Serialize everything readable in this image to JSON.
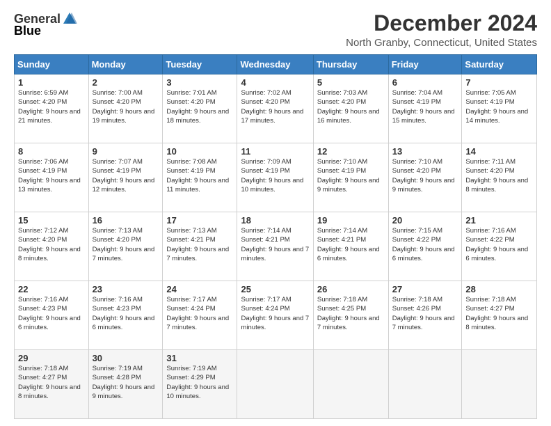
{
  "logo": {
    "general": "General",
    "blue": "Blue"
  },
  "title": "December 2024",
  "location": "North Granby, Connecticut, United States",
  "weekdays": [
    "Sunday",
    "Monday",
    "Tuesday",
    "Wednesday",
    "Thursday",
    "Friday",
    "Saturday"
  ],
  "weeks": [
    [
      {
        "day": "1",
        "sunrise": "6:59 AM",
        "sunset": "4:20 PM",
        "daylight": "9 hours and 21 minutes."
      },
      {
        "day": "2",
        "sunrise": "7:00 AM",
        "sunset": "4:20 PM",
        "daylight": "9 hours and 19 minutes."
      },
      {
        "day": "3",
        "sunrise": "7:01 AM",
        "sunset": "4:20 PM",
        "daylight": "9 hours and 18 minutes."
      },
      {
        "day": "4",
        "sunrise": "7:02 AM",
        "sunset": "4:20 PM",
        "daylight": "9 hours and 17 minutes."
      },
      {
        "day": "5",
        "sunrise": "7:03 AM",
        "sunset": "4:20 PM",
        "daylight": "9 hours and 16 minutes."
      },
      {
        "day": "6",
        "sunrise": "7:04 AM",
        "sunset": "4:19 PM",
        "daylight": "9 hours and 15 minutes."
      },
      {
        "day": "7",
        "sunrise": "7:05 AM",
        "sunset": "4:19 PM",
        "daylight": "9 hours and 14 minutes."
      }
    ],
    [
      {
        "day": "8",
        "sunrise": "7:06 AM",
        "sunset": "4:19 PM",
        "daylight": "9 hours and 13 minutes."
      },
      {
        "day": "9",
        "sunrise": "7:07 AM",
        "sunset": "4:19 PM",
        "daylight": "9 hours and 12 minutes."
      },
      {
        "day": "10",
        "sunrise": "7:08 AM",
        "sunset": "4:19 PM",
        "daylight": "9 hours and 11 minutes."
      },
      {
        "day": "11",
        "sunrise": "7:09 AM",
        "sunset": "4:19 PM",
        "daylight": "9 hours and 10 minutes."
      },
      {
        "day": "12",
        "sunrise": "7:10 AM",
        "sunset": "4:19 PM",
        "daylight": "9 hours and 9 minutes."
      },
      {
        "day": "13",
        "sunrise": "7:10 AM",
        "sunset": "4:20 PM",
        "daylight": "9 hours and 9 minutes."
      },
      {
        "day": "14",
        "sunrise": "7:11 AM",
        "sunset": "4:20 PM",
        "daylight": "9 hours and 8 minutes."
      }
    ],
    [
      {
        "day": "15",
        "sunrise": "7:12 AM",
        "sunset": "4:20 PM",
        "daylight": "9 hours and 8 minutes."
      },
      {
        "day": "16",
        "sunrise": "7:13 AM",
        "sunset": "4:20 PM",
        "daylight": "9 hours and 7 minutes."
      },
      {
        "day": "17",
        "sunrise": "7:13 AM",
        "sunset": "4:21 PM",
        "daylight": "9 hours and 7 minutes."
      },
      {
        "day": "18",
        "sunrise": "7:14 AM",
        "sunset": "4:21 PM",
        "daylight": "9 hours and 7 minutes."
      },
      {
        "day": "19",
        "sunrise": "7:14 AM",
        "sunset": "4:21 PM",
        "daylight": "9 hours and 6 minutes."
      },
      {
        "day": "20",
        "sunrise": "7:15 AM",
        "sunset": "4:22 PM",
        "daylight": "9 hours and 6 minutes."
      },
      {
        "day": "21",
        "sunrise": "7:16 AM",
        "sunset": "4:22 PM",
        "daylight": "9 hours and 6 minutes."
      }
    ],
    [
      {
        "day": "22",
        "sunrise": "7:16 AM",
        "sunset": "4:23 PM",
        "daylight": "9 hours and 6 minutes."
      },
      {
        "day": "23",
        "sunrise": "7:16 AM",
        "sunset": "4:23 PM",
        "daylight": "9 hours and 6 minutes."
      },
      {
        "day": "24",
        "sunrise": "7:17 AM",
        "sunset": "4:24 PM",
        "daylight": "9 hours and 7 minutes."
      },
      {
        "day": "25",
        "sunrise": "7:17 AM",
        "sunset": "4:24 PM",
        "daylight": "9 hours and 7 minutes."
      },
      {
        "day": "26",
        "sunrise": "7:18 AM",
        "sunset": "4:25 PM",
        "daylight": "9 hours and 7 minutes."
      },
      {
        "day": "27",
        "sunrise": "7:18 AM",
        "sunset": "4:26 PM",
        "daylight": "9 hours and 7 minutes."
      },
      {
        "day": "28",
        "sunrise": "7:18 AM",
        "sunset": "4:27 PM",
        "daylight": "9 hours and 8 minutes."
      }
    ],
    [
      {
        "day": "29",
        "sunrise": "7:18 AM",
        "sunset": "4:27 PM",
        "daylight": "9 hours and 8 minutes."
      },
      {
        "day": "30",
        "sunrise": "7:19 AM",
        "sunset": "4:28 PM",
        "daylight": "9 hours and 9 minutes."
      },
      {
        "day": "31",
        "sunrise": "7:19 AM",
        "sunset": "4:29 PM",
        "daylight": "9 hours and 10 minutes."
      },
      null,
      null,
      null,
      null
    ]
  ]
}
